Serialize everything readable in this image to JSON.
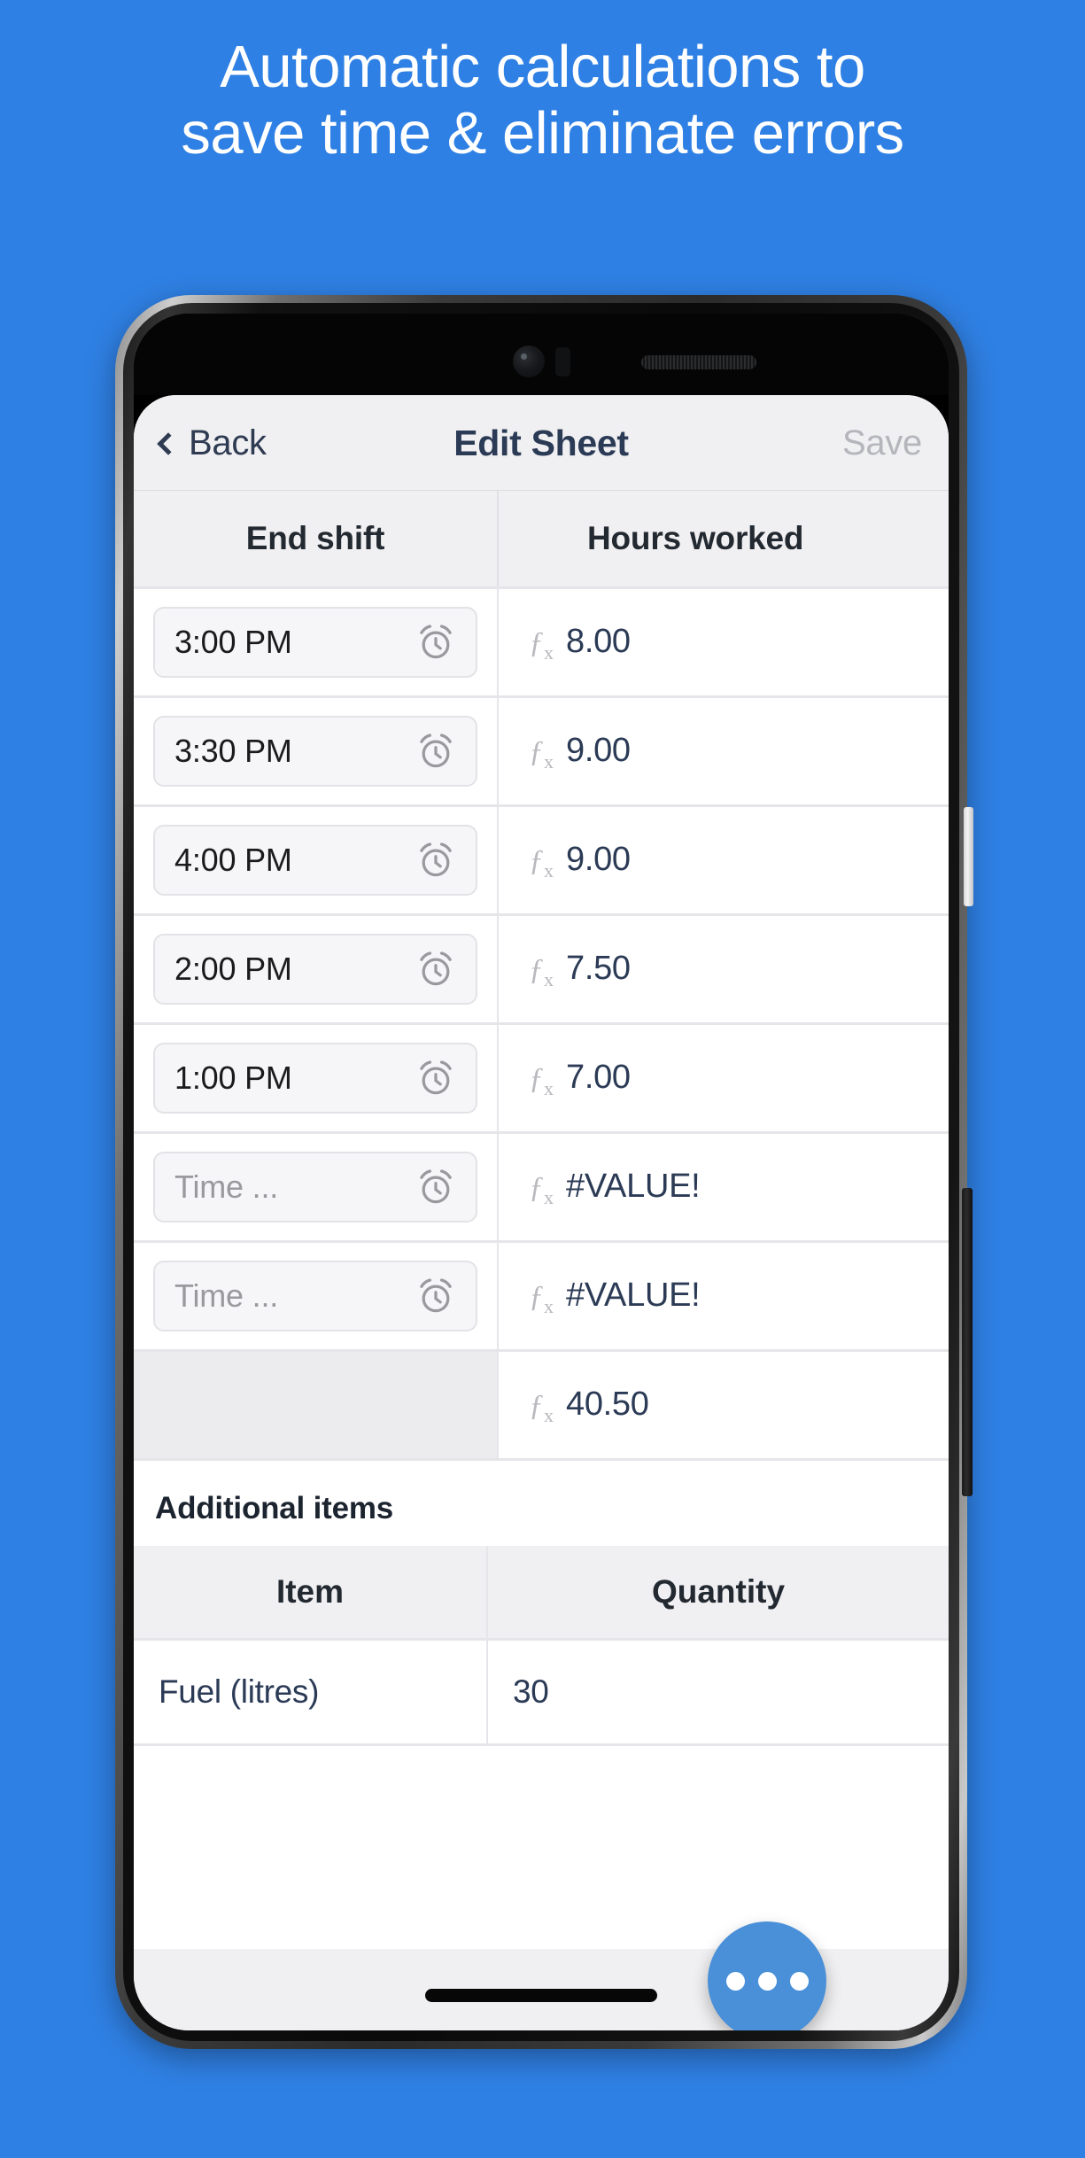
{
  "headline": {
    "line1": "Automatic calculations to",
    "line2": "save time & eliminate errors"
  },
  "colors": {
    "background": "#2F80E4",
    "accent": "#4A90D9",
    "text_dark": "#2B3A55",
    "text_muted": "#9A9A9E",
    "nav_disabled": "#B4B6BC"
  },
  "app": {
    "navbar": {
      "back_label": "Back",
      "title": "Edit Sheet",
      "save_label": "Save"
    },
    "timesheet": {
      "columns": [
        "End shift",
        "Hours worked"
      ],
      "rows": [
        {
          "end_shift": "3:00 PM",
          "hours": "8.00",
          "formula": true,
          "empty": false
        },
        {
          "end_shift": "3:30 PM",
          "hours": "9.00",
          "formula": true,
          "empty": false
        },
        {
          "end_shift": "4:00 PM",
          "hours": "9.00",
          "formula": true,
          "empty": false
        },
        {
          "end_shift": "2:00 PM",
          "hours": "7.50",
          "formula": true,
          "empty": false
        },
        {
          "end_shift": "1:00 PM",
          "hours": "7.00",
          "formula": true,
          "empty": false
        },
        {
          "end_shift": "",
          "hours": "#VALUE!",
          "formula": true,
          "empty": true
        },
        {
          "end_shift": "",
          "hours": "#VALUE!",
          "formula": true,
          "empty": true
        }
      ],
      "time_placeholder": "Time ...",
      "total": {
        "hours": "40.50",
        "formula": true
      },
      "formula_symbol": "f",
      "formula_subscript": "x"
    },
    "additional_items": {
      "section_title": "Additional items",
      "columns": [
        "Item",
        "Quantity"
      ],
      "rows": [
        {
          "item": "Fuel (litres)",
          "quantity": "30"
        }
      ]
    },
    "fab": {
      "label": "more-options"
    }
  }
}
